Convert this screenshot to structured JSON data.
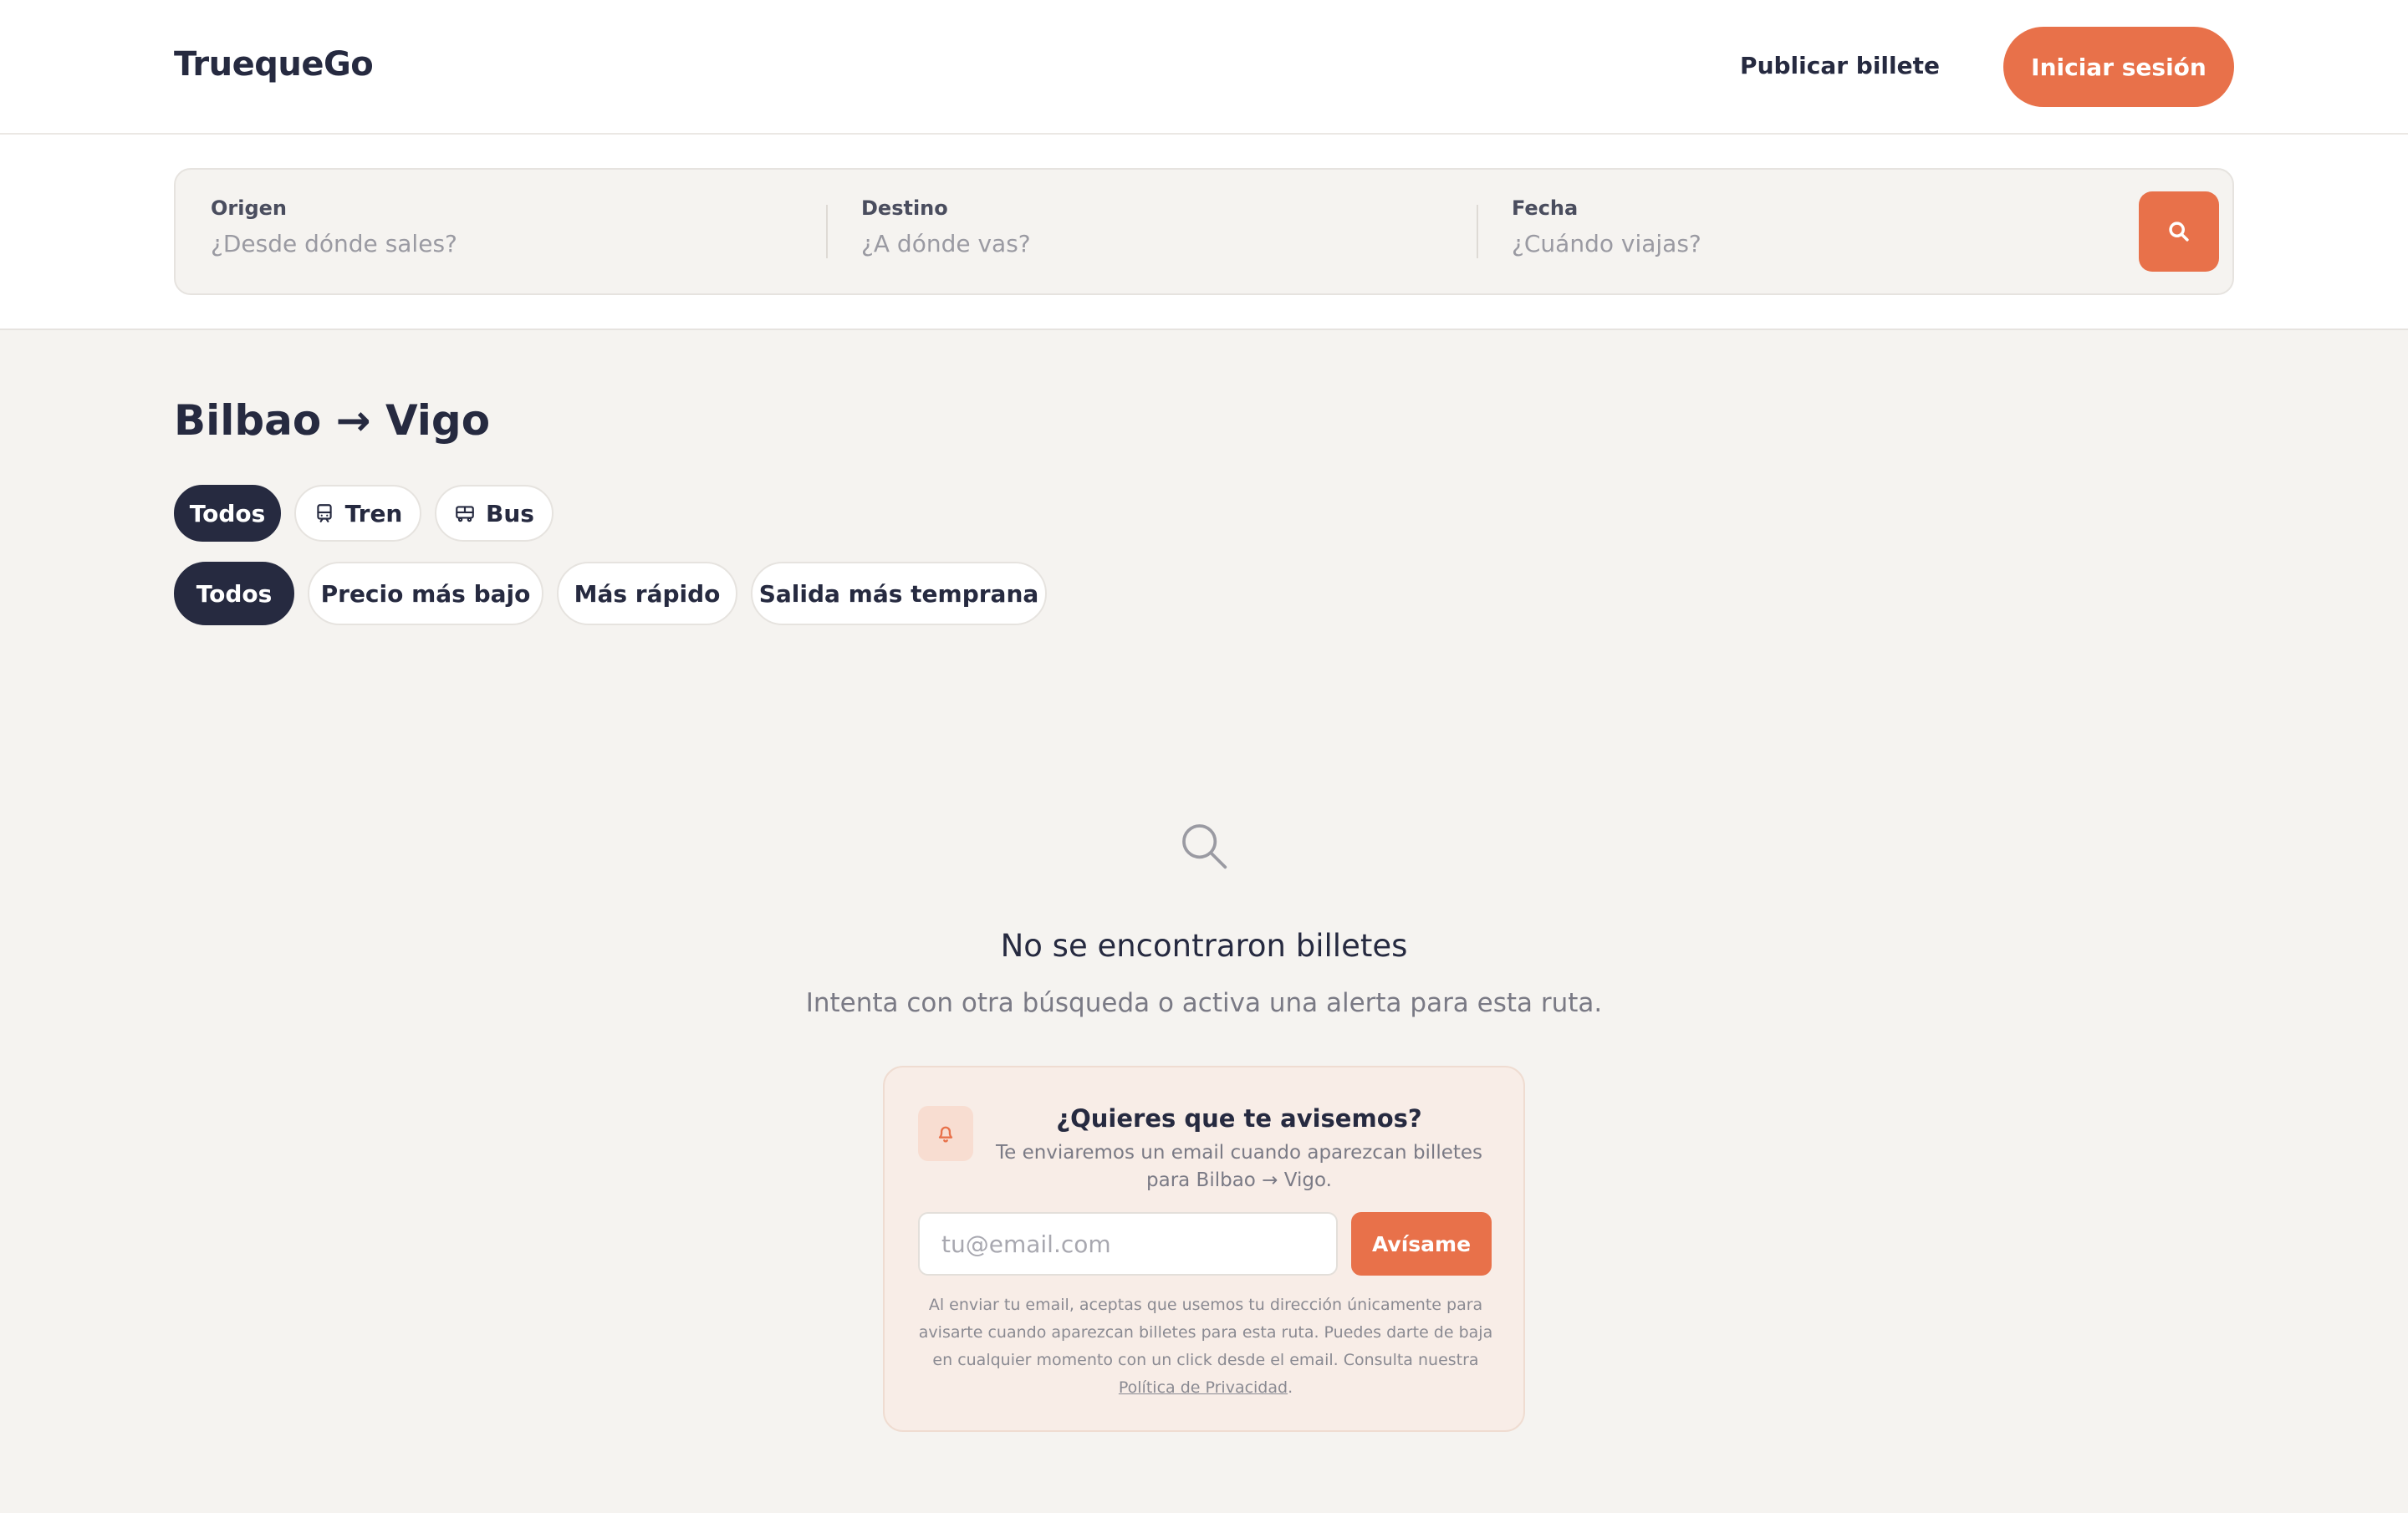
{
  "header": {
    "logo": "TruequeGo",
    "publish_label": "Publicar billete",
    "login_label": "Iniciar sesión"
  },
  "search": {
    "origin_label": "Origen",
    "origin_placeholder": "¿Desde dónde sales?",
    "destination_label": "Destino",
    "destination_placeholder": "¿A dónde vas?",
    "date_label": "Fecha",
    "date_placeholder": "¿Cuándo viajas?",
    "button_icon": "search-icon"
  },
  "results": {
    "route_title": "Bilbao → Vigo",
    "transport_filters": [
      {
        "label": "Todos",
        "icon": null,
        "active": true
      },
      {
        "label": "Tren",
        "icon": "train-icon",
        "active": false
      },
      {
        "label": "Bus",
        "icon": "bus-icon",
        "active": false
      }
    ],
    "sort_filters": [
      {
        "label": "Todos",
        "active": true
      },
      {
        "label": "Precio más bajo",
        "active": false
      },
      {
        "label": "Más rápido",
        "active": false
      },
      {
        "label": "Salida más temprana",
        "active": false
      }
    ]
  },
  "empty_state": {
    "icon": "search-icon",
    "title": "No se encontraron billetes",
    "subtitle": "Intenta con otra búsqueda o activa una alerta para esta ruta."
  },
  "alert": {
    "icon": "bell-icon",
    "title": "¿Quieres que te avisemos?",
    "description": "Te enviaremos un email cuando aparezcan billetes para Bilbao → Vigo.",
    "email_placeholder": "tu@email.com",
    "button_label": "Avísame",
    "legal_text": "Al enviar tu email, aceptas que usemos tu dirección únicamente para avisarte cuando aparezcan billetes para esta ruta. Puedes darte de baja en cualquier momento con un click desde el email. Consulta nuestra",
    "privacy_link": "Política de Privacidad",
    "legal_end": "."
  },
  "colors": {
    "accent": "#e8714a",
    "dark": "#262a40",
    "background": "#f5f3f0",
    "alert_background": "#f8ede7"
  }
}
